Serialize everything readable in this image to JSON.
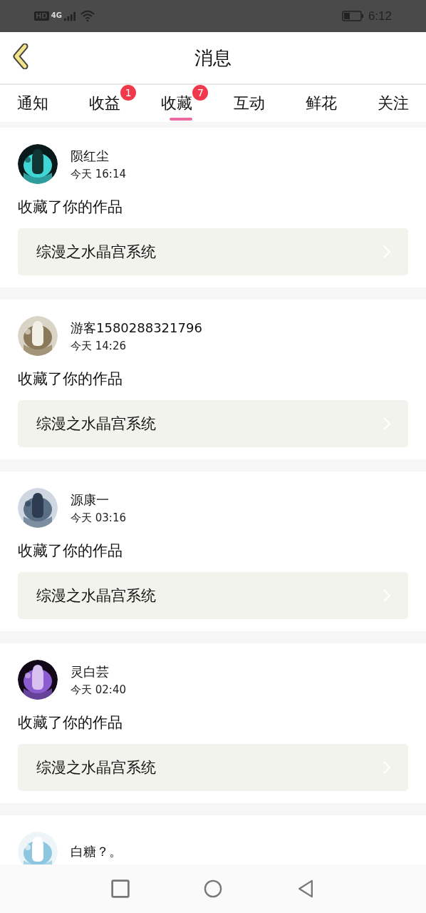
{
  "status_bar": {
    "hd": "HD",
    "network": "4G",
    "time": "6:12"
  },
  "header": {
    "title": "消息"
  },
  "tabs": [
    {
      "label": "通知",
      "selected": false
    },
    {
      "label": "收益",
      "selected": false,
      "badge": "1"
    },
    {
      "label": "收藏",
      "selected": true,
      "badge": "7"
    },
    {
      "label": "互动",
      "selected": false
    },
    {
      "label": "鲜花",
      "selected": false
    },
    {
      "label": "关注",
      "selected": false
    }
  ],
  "messages": [
    {
      "name": "陨红尘",
      "time": "今天 16:14",
      "action": "收藏了你的作品",
      "work": "综漫之水晶宫系统"
    },
    {
      "name": "游客1580288321796",
      "time": "今天 14:26",
      "action": "收藏了你的作品",
      "work": "综漫之水晶宫系统"
    },
    {
      "name": "源康一",
      "time": "今天 03:16",
      "action": "收藏了你的作品",
      "work": "综漫之水晶宫系统"
    },
    {
      "name": "灵白芸",
      "time": "今天 02:40",
      "action": "收藏了你的作品",
      "work": "综漫之水晶宫系统"
    },
    {
      "name": "白糖？。"
    }
  ]
}
